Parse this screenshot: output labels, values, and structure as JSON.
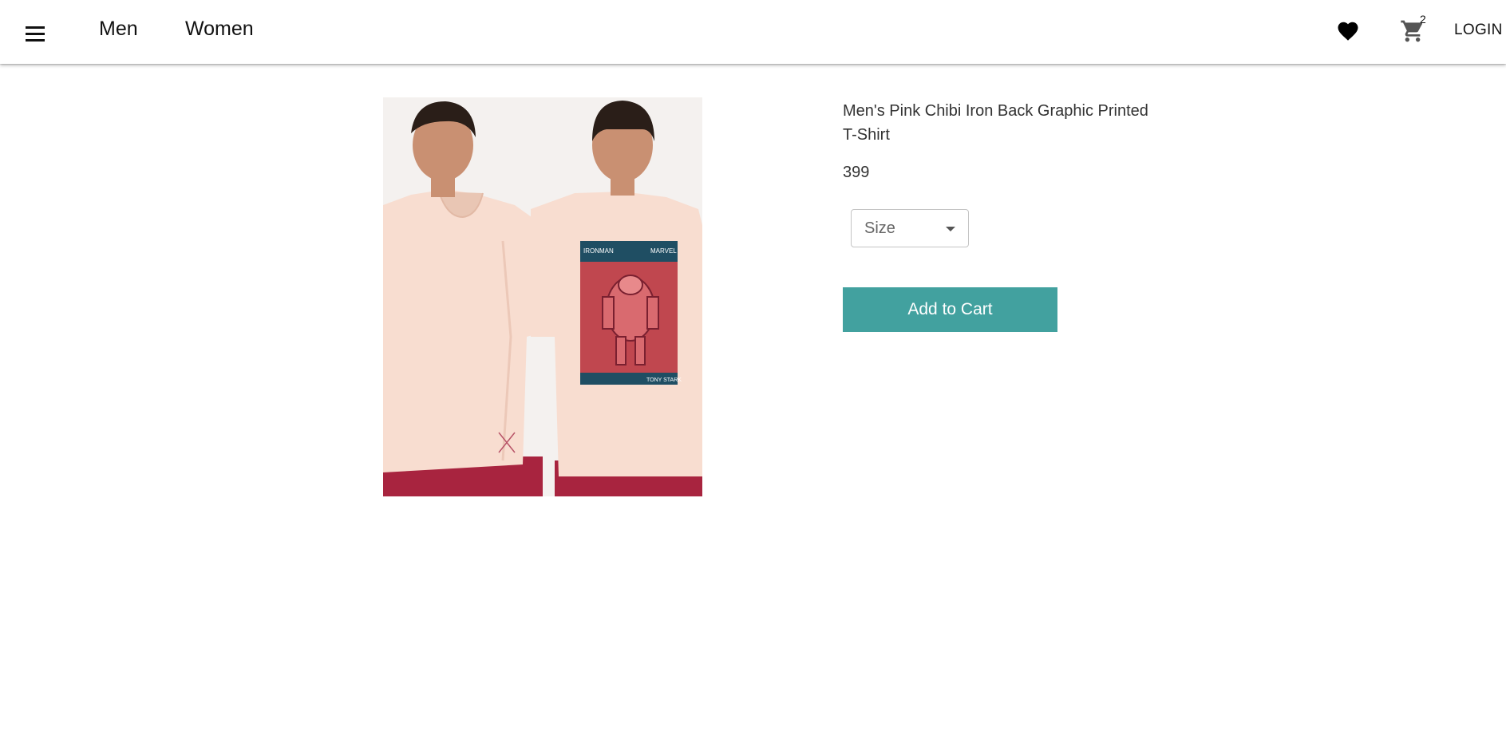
{
  "nav": {
    "menu_icon": "menu-icon",
    "men": "Men",
    "women": "Women",
    "wishlist_icon": "heart-icon",
    "cart_icon": "shopping-cart-icon",
    "cart_count": "2",
    "login": "LOGIN"
  },
  "product": {
    "title": "Men's Pink Chibi Iron Back Graphic Printed T-Shirt",
    "price": "399",
    "size_select": {
      "label": "Size",
      "icon": "chevron-down-icon"
    },
    "add_to_cart": "Add to Cart",
    "image_text": {
      "brand_left": "IRONMAN",
      "brand_right": "MARVEL",
      "caption": "TONY STARK"
    }
  },
  "colors": {
    "accent": "#42a19f",
    "shirt": "#f8ddd0",
    "shorts": "#a8243f",
    "poster_bg": "#c0474f"
  }
}
